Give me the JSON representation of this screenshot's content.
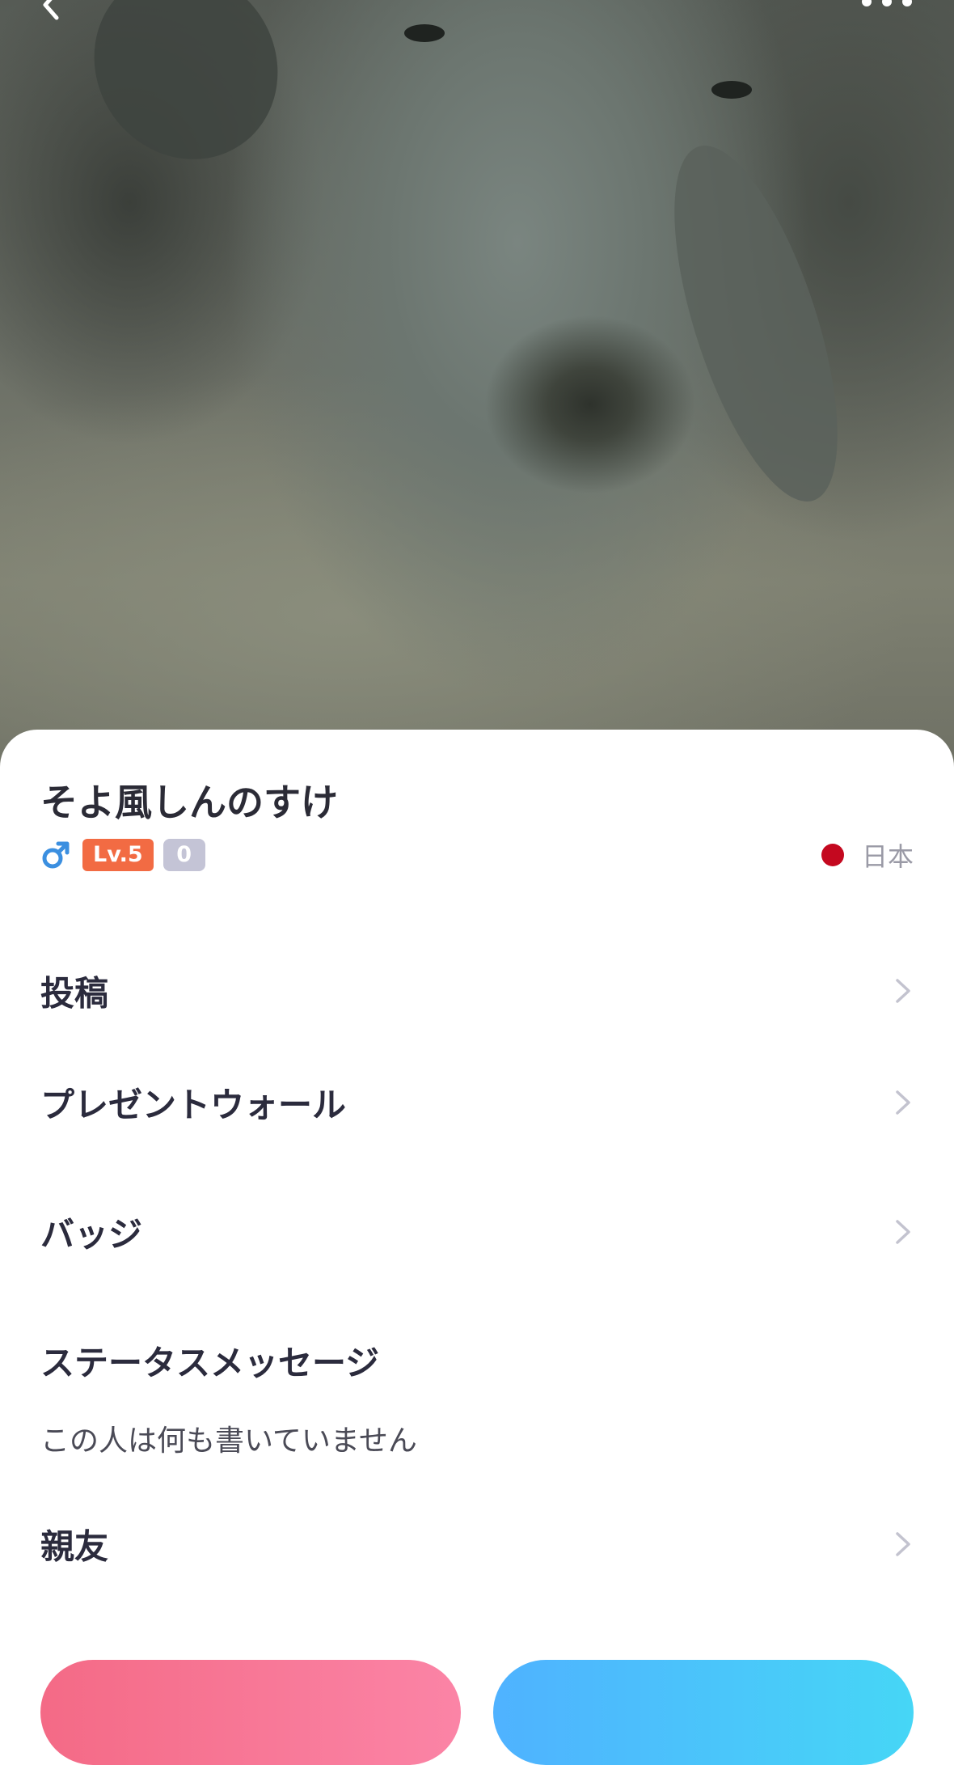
{
  "header": {
    "back_icon": "chevron-left-icon",
    "more_icon": "more-horizontal-icon"
  },
  "profile": {
    "name": "そよ風しんのすけ",
    "gender_icon": "male-icon",
    "gender_color": "#3b8fe0",
    "level_label": "Lv.5",
    "level_color": "#f26b43",
    "count": "0",
    "country_flag_color": "#c4081f",
    "country": "日本"
  },
  "menu": {
    "posts": "投稿",
    "present_wall": "プレゼントウォール",
    "badges": "バッジ",
    "status_message_title": "ステータスメッセージ",
    "status_message_text": "この人は何も書いていません",
    "best_friends": "親友"
  },
  "actions": {
    "left_button_color": "#f46a86",
    "right_button_color": "#4fb2ff"
  }
}
